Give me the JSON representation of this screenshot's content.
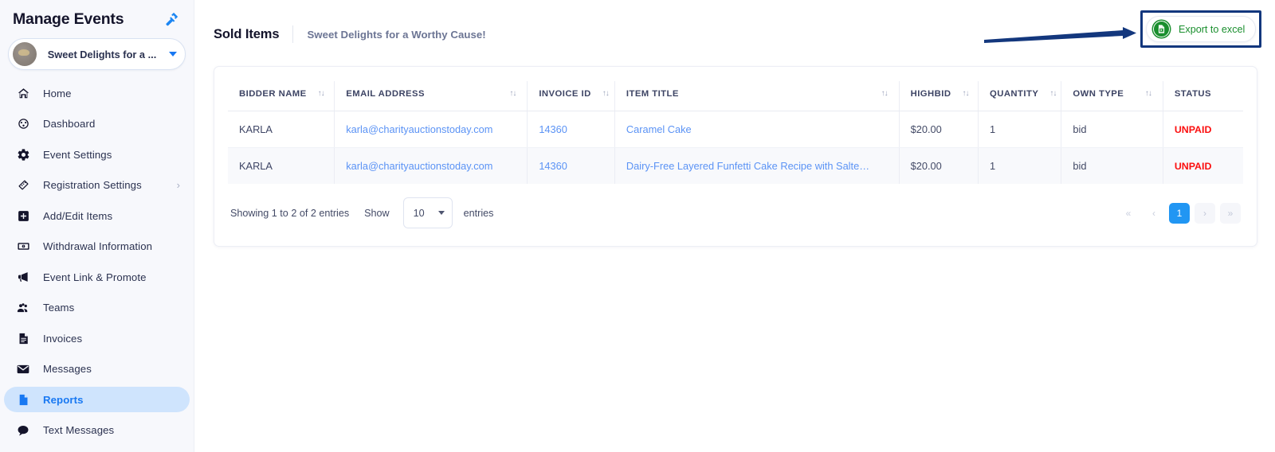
{
  "sidebar": {
    "title": "Manage Events",
    "gavel_icon": "gavel-icon",
    "event_selector": {
      "name": "Sweet Delights for a ...",
      "avatar": "event-avatar",
      "caret": "chevron-down-icon"
    },
    "items": [
      {
        "label": "Home",
        "icon": "home-icon",
        "active": false,
        "chevron": ""
      },
      {
        "label": "Dashboard",
        "icon": "dashboard-gauge-icon",
        "active": false,
        "chevron": ""
      },
      {
        "label": "Event Settings",
        "icon": "gear-icon",
        "active": false,
        "chevron": ""
      },
      {
        "label": "Registration Settings",
        "icon": "ticket-icon",
        "active": false,
        "chevron": "›"
      },
      {
        "label": "Add/Edit Items",
        "icon": "plus-square-icon",
        "active": false,
        "chevron": ""
      },
      {
        "label": "Withdrawal Information",
        "icon": "money-bill-icon",
        "active": false,
        "chevron": ""
      },
      {
        "label": "Event Link & Promote",
        "icon": "megaphone-icon",
        "active": false,
        "chevron": ""
      },
      {
        "label": "Teams",
        "icon": "people-group-icon",
        "active": false,
        "chevron": ""
      },
      {
        "label": "Invoices",
        "icon": "invoice-document-icon",
        "active": false,
        "chevron": ""
      },
      {
        "label": "Messages",
        "icon": "envelope-icon",
        "active": false,
        "chevron": ""
      },
      {
        "label": "Reports",
        "icon": "report-file-icon",
        "active": true,
        "chevron": ""
      },
      {
        "label": "Text Messages",
        "icon": "chat-bubble-icon",
        "active": false,
        "chevron": ""
      }
    ]
  },
  "header": {
    "page_title": "Sold Items",
    "event_name": "Sweet Delights for a Worthy Cause!",
    "export_button_label": "Export to excel",
    "export_icon": "excel-file-icon",
    "annotation_color": "#13377d",
    "accent_green": "#1a8f2e"
  },
  "table": {
    "columns": [
      {
        "label": "BIDDER NAME",
        "sortable": true
      },
      {
        "label": "EMAIL ADDRESS",
        "sortable": true
      },
      {
        "label": "INVOICE ID",
        "sortable": true
      },
      {
        "label": "ITEM TITLE",
        "sortable": true
      },
      {
        "label": "HIGHBID",
        "sortable": true
      },
      {
        "label": "QUANTITY",
        "sortable": true
      },
      {
        "label": "OWN TYPE",
        "sortable": true
      },
      {
        "label": "STATUS",
        "sortable": false
      }
    ],
    "sort_glyph": "↑↓",
    "rows": [
      {
        "bidder_name": "KARLA",
        "email": "karla@charityauctionstoday.com",
        "invoice_id": "14360",
        "item_title": "Caramel Cake",
        "highbid": "$20.00",
        "quantity": "1",
        "own_type": "bid",
        "status": "UNPAID"
      },
      {
        "bidder_name": "KARLA",
        "email": "karla@charityauctionstoday.com",
        "invoice_id": "14360",
        "item_title": "Dairy-Free Layered Funfetti Cake Recipe with Salte…",
        "highbid": "$20.00",
        "quantity": "1",
        "own_type": "bid",
        "status": "UNPAID"
      }
    ]
  },
  "footer": {
    "showing_text": "Showing 1 to 2 of 2 entries",
    "show_label": "Show",
    "page_length": "10",
    "entries_label": "entries",
    "pagination": [
      {
        "label": "«",
        "name": "pagination-first",
        "state": "disabled"
      },
      {
        "label": "‹",
        "name": "pagination-prev",
        "state": "disabled"
      },
      {
        "label": "1",
        "name": "pagination-page-1",
        "state": "active"
      },
      {
        "label": "›",
        "name": "pagination-next",
        "state": "ghost"
      },
      {
        "label": "»",
        "name": "pagination-last",
        "state": "ghost"
      }
    ]
  }
}
